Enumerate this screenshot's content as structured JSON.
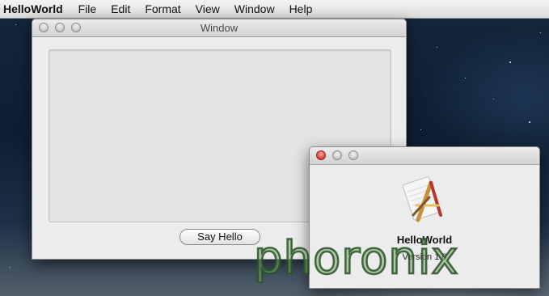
{
  "menubar": {
    "app_name": "HelloWorld",
    "items": [
      "File",
      "Edit",
      "Format",
      "View",
      "Window",
      "Help"
    ]
  },
  "main_window": {
    "title": "Window",
    "button_label": "Say Hello"
  },
  "about_window": {
    "app_name": "HelloWorld",
    "version": "Version 1.0",
    "icon": "xcode-app-icon"
  },
  "watermark": {
    "text": "phoronix"
  },
  "colors": {
    "close_button": "#e2493d",
    "watermark_fill": "#78aa64"
  }
}
